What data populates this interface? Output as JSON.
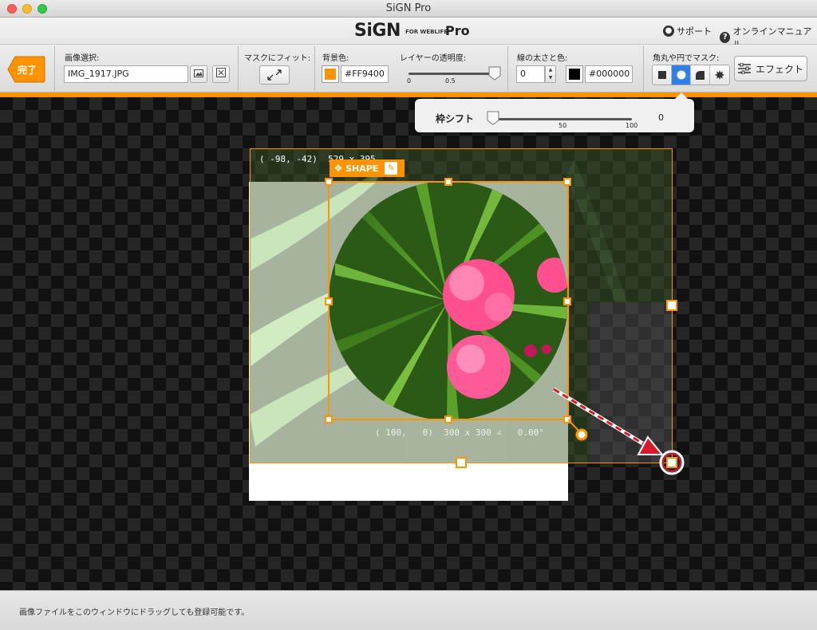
{
  "window": {
    "title": "SiGN Pro"
  },
  "brand": {
    "logo": "SiGN",
    "logo_sub": "FOR WEBLIFE*",
    "logo_pro": "Pro"
  },
  "help": {
    "support": "サポート",
    "manual": "オンラインマニュアル"
  },
  "toolbar": {
    "done_label": "完了",
    "image_select_label": "画像選択:",
    "image_file": "IMG_1917.JPG",
    "fit_label": "マスクにフィット:",
    "bg_color_label": "背景色:",
    "bg_color_value": "#FF9400",
    "bg_color": "#FF9400",
    "opacity_label": "レイヤーの透明度:",
    "opacity_min": "0",
    "opacity_mid": "0.5",
    "opacity": 1,
    "stroke_label": "線の太さと色:",
    "stroke_width": "0",
    "stroke_color_value": "#000000",
    "stroke_color": "#000000",
    "mask_label": "角丸や円でマスク:",
    "mask_shapes": [
      "square",
      "circle",
      "rounded-corner",
      "starburst"
    ],
    "mask_selected": "circle",
    "effect_label": "エフェクト"
  },
  "popover": {
    "label": "枠シフト",
    "tick_mid": "50",
    "tick_max": "100",
    "value": "0"
  },
  "canvas": {
    "image_info": "( -98, -42)  529 x 395",
    "shape_label": "SHAPE",
    "shape_info": "( 100,   0)  300 x 300 ∠   0.00°"
  },
  "status": {
    "text": "画像ファイルをこのウィンドウにドラッグしても登録可能です。"
  },
  "colors": {
    "accent": "#FF9400",
    "selected": "#2F7FE4"
  }
}
